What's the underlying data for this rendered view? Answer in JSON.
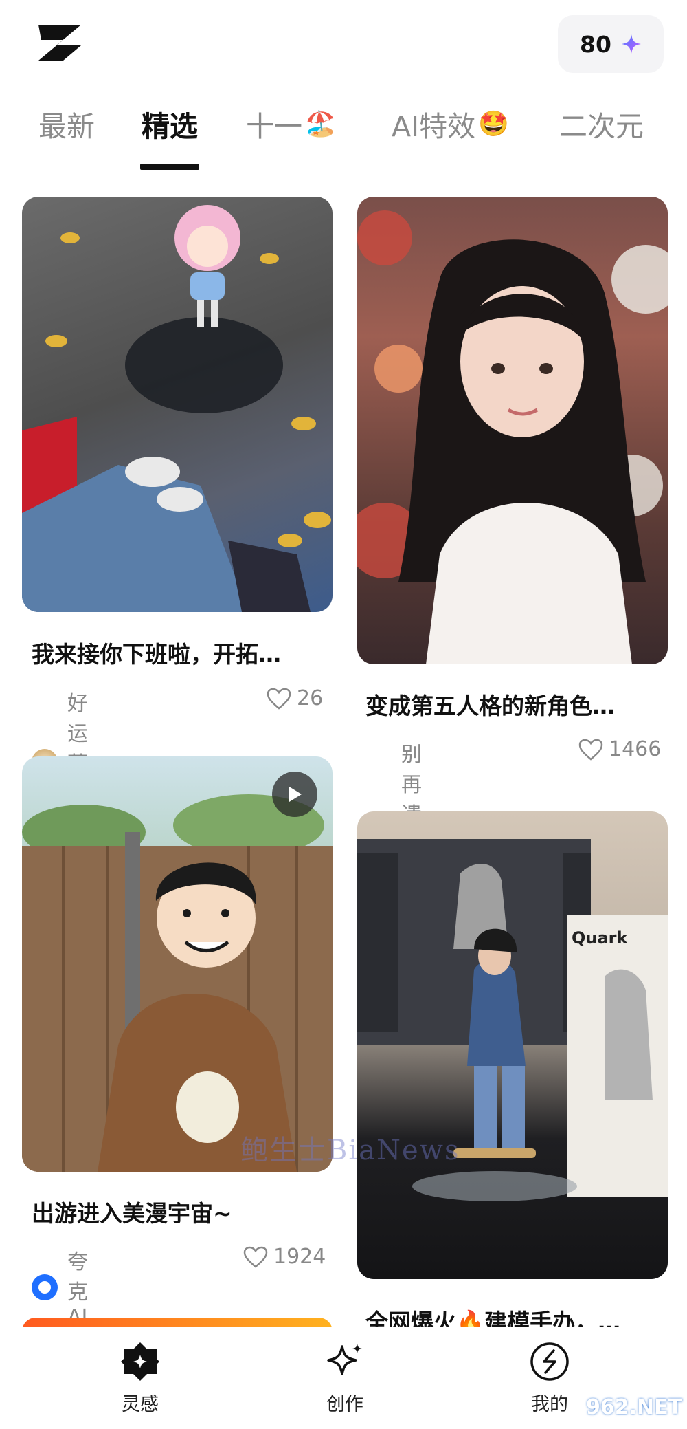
{
  "header": {
    "credits": "80"
  },
  "tabs": [
    {
      "label": "最新",
      "emoji": ""
    },
    {
      "label": "精选",
      "emoji": ""
    },
    {
      "label": "十一",
      "emoji": "🏖️"
    },
    {
      "label": "AI特效",
      "emoji": "🤩"
    },
    {
      "label": "二次元",
      "emoji": ""
    }
  ],
  "feed": [
    {
      "title": "我来接你下班啦，开拓…",
      "author": "好运蘑菇王",
      "likes": "26"
    },
    {
      "title": "变成第五人格的新角色…",
      "author": "别再遗忘小猫",
      "likes": "1466"
    },
    {
      "title": "出游进入美漫宇宙~",
      "author": "夸克AI",
      "likes": "1924"
    },
    {
      "title": "全网爆火🔥建模手办，…",
      "author": "",
      "likes": ""
    }
  ],
  "product_box_label": "Quark",
  "watermark": "鲍生士BiaNews",
  "bottom_nav": [
    {
      "label": "灵感"
    },
    {
      "label": "创作"
    },
    {
      "label": "我的"
    }
  ],
  "site_badge": "962.NET",
  "colors": {
    "accent": "#7b61ff",
    "active_tab": "#111111",
    "muted": "#8a8a8a"
  }
}
